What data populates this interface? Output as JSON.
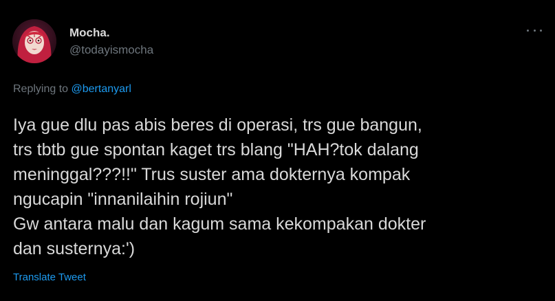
{
  "tweet": {
    "author": {
      "display_name": "Mocha.",
      "handle": "@todayismocha"
    },
    "more_icon": "more-horizontal-icon",
    "replying": {
      "prefix": "Replying to",
      "mention": "@bertanyarl"
    },
    "text_lines": [
      "Iya gue dlu pas abis beres di operasi, trs gue bangun,",
      "trs tbtb gue spontan kaget trs blang \"HAH?tok dalang",
      "meninggal???!!\" Trus suster ama dokternya kompak",
      "ngucapin \"innanilaihin rojiun\"",
      "Gw antara malu dan kagum sama kekompakan dokter",
      "dan susternya:')"
    ],
    "translate_label": "Translate Tweet"
  },
  "colors": {
    "background": "#000000",
    "text_primary": "#d9d9d9",
    "text_secondary": "#6e767d",
    "accent": "#1d9bf0"
  }
}
